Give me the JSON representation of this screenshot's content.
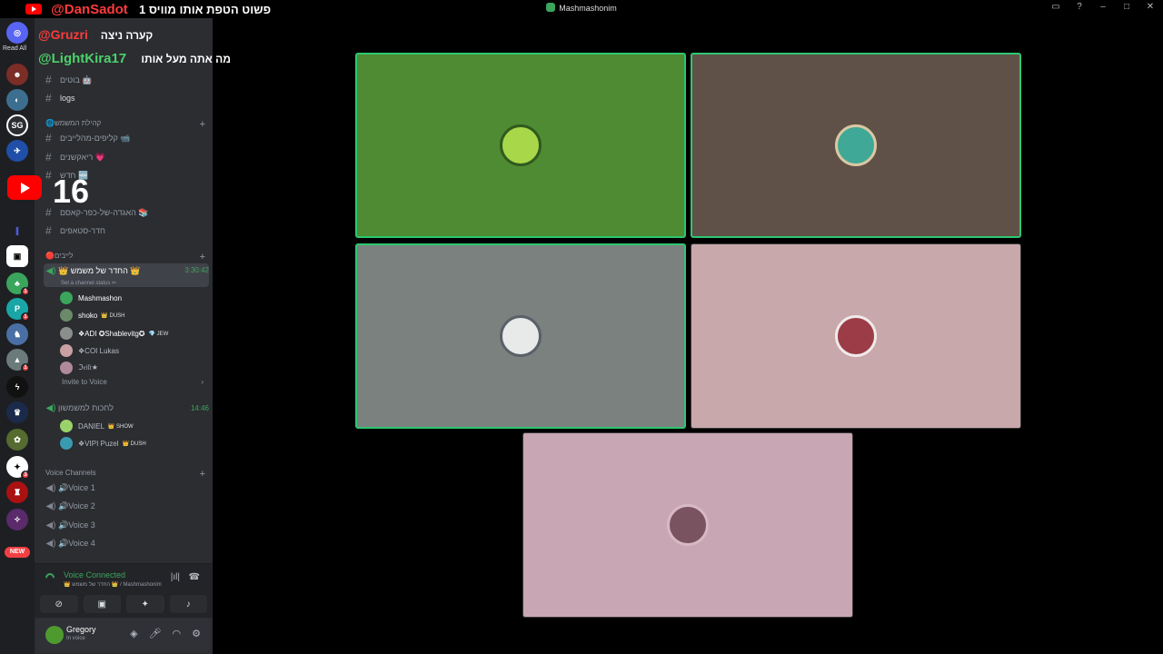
{
  "window": {
    "title": "Mashmashonim"
  },
  "overlay": {
    "line1_handle": "@DanSadot",
    "line1_msg": "פשוט הטפת אותו מוויס 1",
    "line2_handle": "@Gruzri",
    "line2_msg": "קערה ניצה",
    "line3_handle": "@LightKira17",
    "line3_msg": "מה אתה מעל אותו",
    "big_number": "16"
  },
  "servers": {
    "read_all": "Read All",
    "new_label": "NEW",
    "sg_label": "SG"
  },
  "channels": {
    "text": [
      {
        "name": "בוטים 🤖"
      },
      {
        "name": "logs"
      }
    ],
    "community_category": "🌐קהילת המשמש",
    "community_channels": [
      {
        "name": "קליפים-מהלייבים 📹"
      },
      {
        "name": "ריאקשנים 💗"
      },
      {
        "name": "חדש 🆕"
      },
      {
        "name": "האגדה-של-כפר-קאסם 📚"
      },
      {
        "name": "חדר-סטאפים"
      }
    ],
    "lives_category": "🔴לייבים",
    "active_voice": {
      "name": "👑 החדר של משמש 👑",
      "time": "3:30:42",
      "status": "Set a channel status ✏"
    },
    "voice_users": [
      {
        "name": "Mashmashon",
        "tag": ""
      },
      {
        "name": "shoko",
        "tag": "👑 DUSH"
      },
      {
        "name": "❖ADI ✪Shablevitg✪",
        "tag": "💎 JEW"
      },
      {
        "name": "❖COI Lukas",
        "tag": ""
      },
      {
        "name": "ℑ𝔢𝔦𝔩𝔦★",
        "tag": ""
      }
    ],
    "invite_label": "Invite to Voice",
    "waiting_voice": {
      "name": "לחכות למשמשון",
      "time": "14:46"
    },
    "waiting_users": [
      {
        "name": "DANIEL",
        "tag": "👑 SHOW"
      },
      {
        "name": "❖VIPI Puzel",
        "tag": "👑 DUSH"
      }
    ],
    "voice_category": "Voice Channels",
    "voice_channels": [
      {
        "name": "🔊Voice 1"
      },
      {
        "name": "🔊Voice 2"
      },
      {
        "name": "🔊Voice 3"
      },
      {
        "name": "🔊Voice 4"
      }
    ]
  },
  "voice_panel": {
    "state": "Voice Connected",
    "sub": "👑 החדר של משמש 👑 / Mashmashonim"
  },
  "user_panel": {
    "name": "Gregory",
    "status": "In voice"
  },
  "colors": {
    "green_tile": "#4f8b32",
    "brown_tile": "#605148",
    "gray_tile": "#7a817e",
    "pink_tile": "#c8a8aa",
    "pink_tile2": "#c8a6b4",
    "speaking_border": "#2dc770"
  }
}
